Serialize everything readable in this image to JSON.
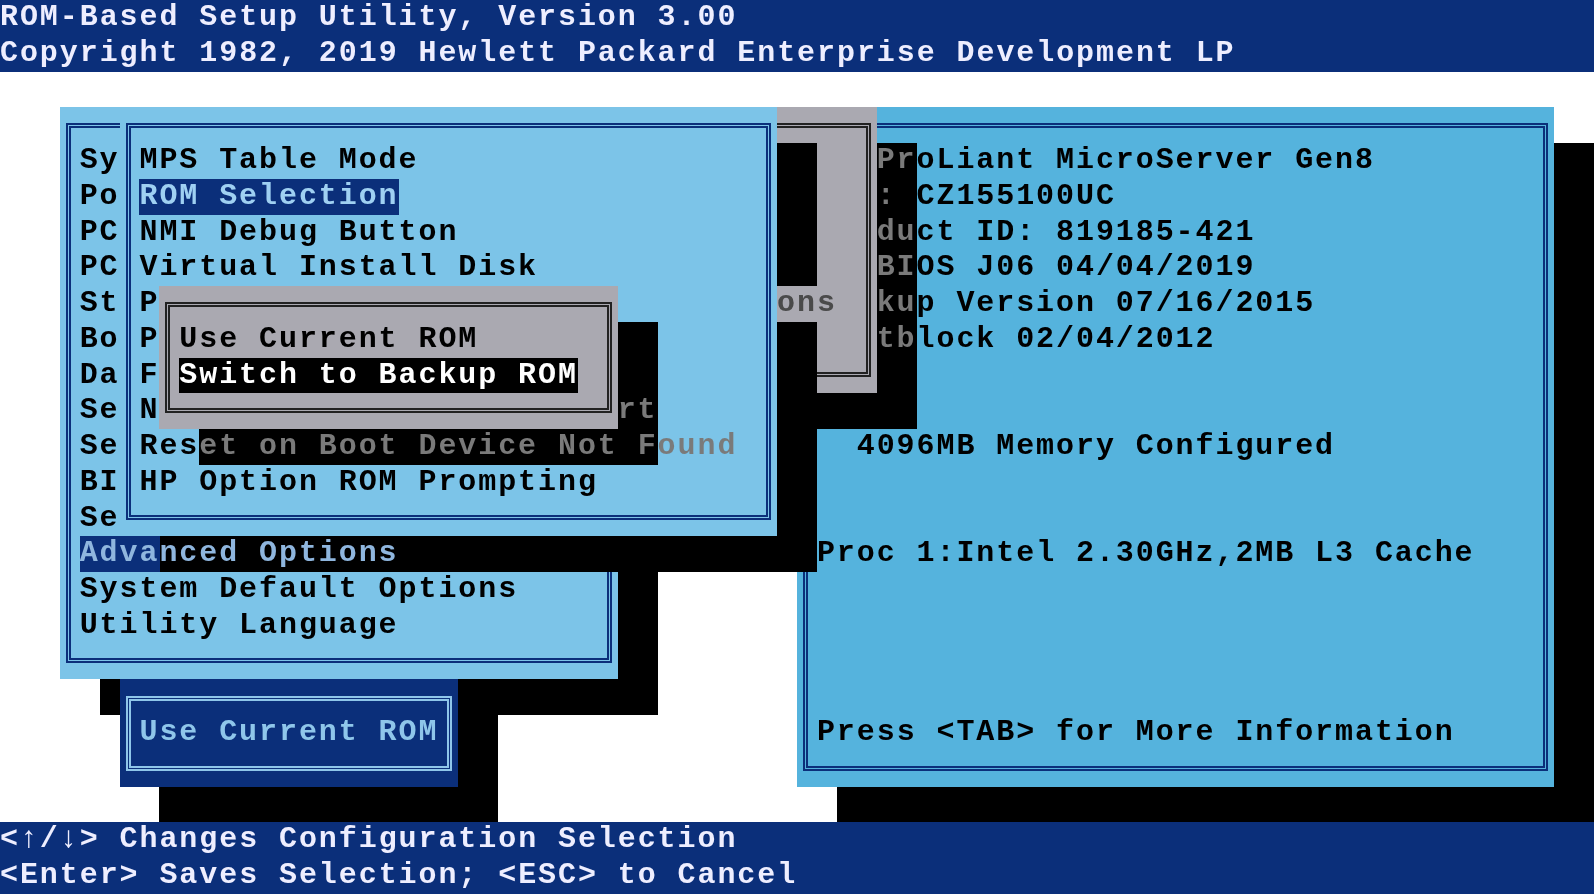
{
  "header": {
    "title": "ROM-Based Setup Utility, Version 3.00",
    "copyright": "Copyright 1982, 2019 Hewlett Packard Enterprise Development LP"
  },
  "main_menu": {
    "items": [
      {
        "label": "Sy",
        "selected": false
      },
      {
        "label": "Po",
        "selected": false
      },
      {
        "label": "PC",
        "selected": false
      },
      {
        "label": "PC",
        "selected": false
      },
      {
        "label": "St",
        "selected": false
      },
      {
        "label": "Bo",
        "selected": false
      },
      {
        "label": "Da",
        "selected": false
      },
      {
        "label": "Se",
        "selected": false
      },
      {
        "label": "Se",
        "selected": false
      },
      {
        "label": "BI",
        "selected": false
      },
      {
        "label": "Se",
        "selected": false
      },
      {
        "label": "Advanced Options",
        "selected": true
      },
      {
        "label": "System Default Options",
        "selected": false
      },
      {
        "label": "Utility Language",
        "selected": false
      }
    ]
  },
  "submenu": {
    "items": [
      {
        "label": "MPS Table Mode",
        "selected": false
      },
      {
        "label": "ROM Selection",
        "selected": true
      },
      {
        "label": "NMI Debug Button",
        "selected": false
      },
      {
        "label": "Virtual Install Disk",
        "selected": false
      },
      {
        "label": "P",
        "selected": false
      },
      {
        "label": "P",
        "selected": false
      },
      {
        "label": "F",
        "selected": false
      },
      {
        "label": "N",
        "selected": false,
        "tail": "rt"
      },
      {
        "label": "Reset on Boot Device Not Found",
        "selected": false
      },
      {
        "label": "HP Option ROM Prompting",
        "selected": false
      }
    ]
  },
  "background_dialog": {
    "text": "ons"
  },
  "popup": {
    "options": [
      {
        "label": "Use Current ROM",
        "selected": false
      },
      {
        "label": "Switch to Backup ROM",
        "selected": true
      }
    ]
  },
  "info_panel": {
    "lines": [
      "ProLiant MicroServer Gen8",
      ": CZ155100UC",
      "duct ID: 819185-421",
      "BIOS J06 04/04/2019",
      "kup Version 07/16/2015",
      "tblock 02/04/2012"
    ],
    "memory": "4096MB Memory Configured",
    "processor": "Proc 1:Intel 2.30GHz,2MB L3 Cache",
    "hint": "Press <TAB> for More Information"
  },
  "current_value": {
    "text": "Use Current ROM"
  },
  "status_bar": {
    "lines": [
      "<↑/↓> Changes Configuration Selection",
      "<Enter> Saves Selection; <ESC> to Cancel"
    ]
  }
}
